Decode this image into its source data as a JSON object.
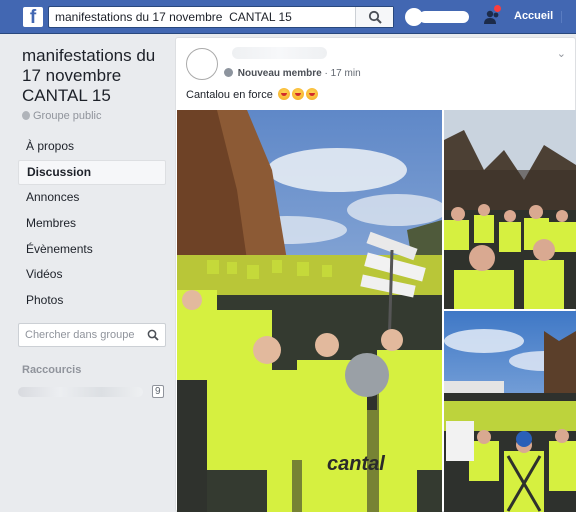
{
  "topbar": {
    "search_value": "manifestations du 17 novembre  CANTAL 15",
    "home_label": "Accueil",
    "logo_letter": "f"
  },
  "group": {
    "title": "manifestations du 17 novembre CANTAL 15",
    "type": "Groupe public"
  },
  "nav": {
    "items": [
      {
        "label": "À propos"
      },
      {
        "label": "Discussion",
        "active": true
      },
      {
        "label": "Annonces"
      },
      {
        "label": "Membres"
      },
      {
        "label": "Évènements"
      },
      {
        "label": "Vidéos"
      },
      {
        "label": "Photos"
      }
    ]
  },
  "group_search": {
    "placeholder": "Chercher dans groupe"
  },
  "shortcuts": {
    "heading": "Raccourcis",
    "count": "9"
  },
  "post": {
    "role": "Nouveau membre",
    "separator": "·",
    "time": "17 min",
    "text": "Cantalou en force",
    "vest_text": "cantal"
  },
  "colors": {
    "brand": "#4267b2",
    "vest": "#d6f040",
    "background": "#e9ebee"
  }
}
